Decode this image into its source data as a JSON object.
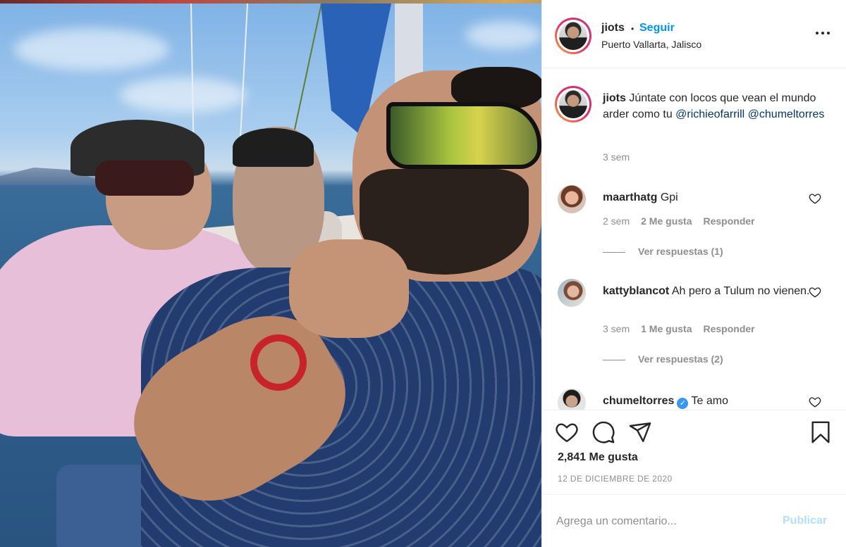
{
  "header": {
    "username": "jiots",
    "separator": "•",
    "follow_label": "Seguir",
    "location": "Puerto Vallarta, Jalisco",
    "more_icon": "more-horizontal-icon"
  },
  "caption": {
    "username": "jiots",
    "text": " Júntate con locos que vean el mundo arder como tu ",
    "mention1": "@richieofarrill",
    "mention2": "@chumeltorres",
    "time": "3 sem"
  },
  "comments": [
    {
      "username": "maarthatg",
      "text": "Gpi",
      "time": "2 sem",
      "likes": "2 Me gusta",
      "reply_label": "Responder",
      "view_replies": "Ver respuestas (1)"
    },
    {
      "username": "kattyblancot",
      "text": "Ah pero a Tulum no vienen.",
      "time": "3 sem",
      "likes": "1 Me gusta",
      "reply_label": "Responder",
      "view_replies": "Ver respuestas (2)"
    },
    {
      "username": "chumeltorres",
      "verified_mark": "✓",
      "text": "Te amo"
    }
  ],
  "actions": {
    "like_icon": "heart-icon",
    "comment_icon": "comment-icon",
    "share_icon": "send-icon",
    "save_icon": "bookmark-icon",
    "likes_count": "2,841 Me gusta",
    "date": "12 DE DICIEMBRE DE 2020"
  },
  "add_comment": {
    "placeholder": "Agrega un comentario...",
    "publish_label": "Publicar"
  },
  "colors": {
    "follow": "#0095f6",
    "mention": "#00376b",
    "muted": "#8e8e8e",
    "publish_disabled": "#b2dffc"
  }
}
